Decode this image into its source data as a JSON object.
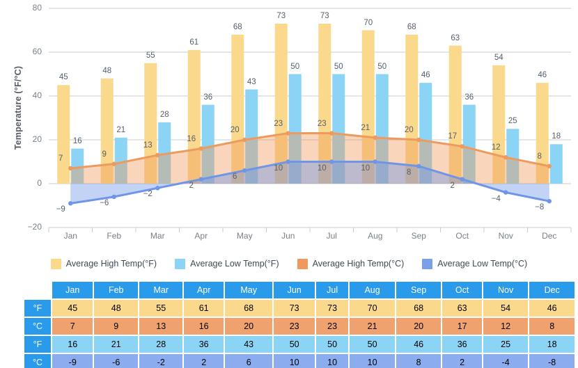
{
  "chart_data": {
    "type": "bar",
    "title": "",
    "xlabel": "",
    "ylabel": "Temperature (°F/°C)",
    "ylim": [
      -20,
      80
    ],
    "yticks": [
      80,
      60,
      40,
      20,
      0,
      -20
    ],
    "grid": true,
    "legend_position": "bottom",
    "categories": [
      "Jan",
      "Feb",
      "Mar",
      "Apr",
      "May",
      "Jun",
      "Jul",
      "Aug",
      "Sep",
      "Oct",
      "Nov",
      "Dec"
    ],
    "series": [
      {
        "name": "Average High Temp(°F)",
        "kind": "bar",
        "color": "#FAD98C",
        "values": [
          45,
          48,
          55,
          61,
          68,
          73,
          73,
          70,
          68,
          63,
          54,
          46
        ]
      },
      {
        "name": "Average Low Temp(°F)",
        "kind": "bar",
        "color": "#8BD4F5",
        "values": [
          16,
          21,
          28,
          36,
          43,
          50,
          50,
          50,
          46,
          36,
          25,
          18
        ]
      },
      {
        "name": "Average High Temp(°C)",
        "kind": "area",
        "color": "#EE9A5E",
        "values": [
          7,
          9,
          13,
          16,
          20,
          23,
          23,
          21,
          20,
          17,
          12,
          8
        ]
      },
      {
        "name": "Average Low Temp(°C)",
        "kind": "area",
        "color": "#6E95E8",
        "values": [
          -9,
          -6,
          -2,
          2,
          6,
          10,
          10,
          10,
          8,
          2,
          -4,
          -8
        ]
      }
    ]
  },
  "axis": {
    "y_title": "Temperature (°F/°C)",
    "ticks": [
      "80",
      "60",
      "40",
      "20",
      "0",
      "-20"
    ],
    "months": [
      "Jan",
      "Feb",
      "Mar",
      "Apr",
      "May",
      "Jun",
      "Jul",
      "Aug",
      "Sep",
      "Oct",
      "Nov",
      "Dec"
    ]
  },
  "legend": {
    "items": [
      {
        "label": "Average High Temp(°F)",
        "color": "#FAD98C"
      },
      {
        "label": "Average Low Temp(°F)",
        "color": "#8BD4F5"
      },
      {
        "label": "Average High Temp(°C)",
        "color": "#EE9A5E"
      },
      {
        "label": "Average Low Temp(°C)",
        "color": "#7B9FE8"
      }
    ]
  },
  "table": {
    "corner": "",
    "columns": [
      "Jan",
      "Feb",
      "Mar",
      "Apr",
      "May",
      "Jun",
      "Jul",
      "Aug",
      "Sep",
      "Oct",
      "Nov",
      "Dec"
    ],
    "header_color": "#2A9AEA",
    "rows": [
      {
        "header": "°F",
        "color": "#FAD98C",
        "values": [
          "45",
          "48",
          "55",
          "61",
          "68",
          "73",
          "73",
          "70",
          "68",
          "63",
          "54",
          "46"
        ]
      },
      {
        "header": "°C",
        "color": "#EFA26E",
        "values": [
          "7",
          "9",
          "13",
          "16",
          "20",
          "23",
          "23",
          "21",
          "20",
          "17",
          "12",
          "8"
        ]
      },
      {
        "header": "°F",
        "color": "#8BD4F5",
        "values": [
          "16",
          "21",
          "28",
          "36",
          "43",
          "50",
          "50",
          "50",
          "46",
          "36",
          "25",
          "18"
        ]
      },
      {
        "header": "°C",
        "color": "#8BACEE",
        "values": [
          "-9",
          "-6",
          "-2",
          "2",
          "6",
          "10",
          "10",
          "10",
          "8",
          "2",
          "-4",
          "-8"
        ]
      }
    ]
  }
}
